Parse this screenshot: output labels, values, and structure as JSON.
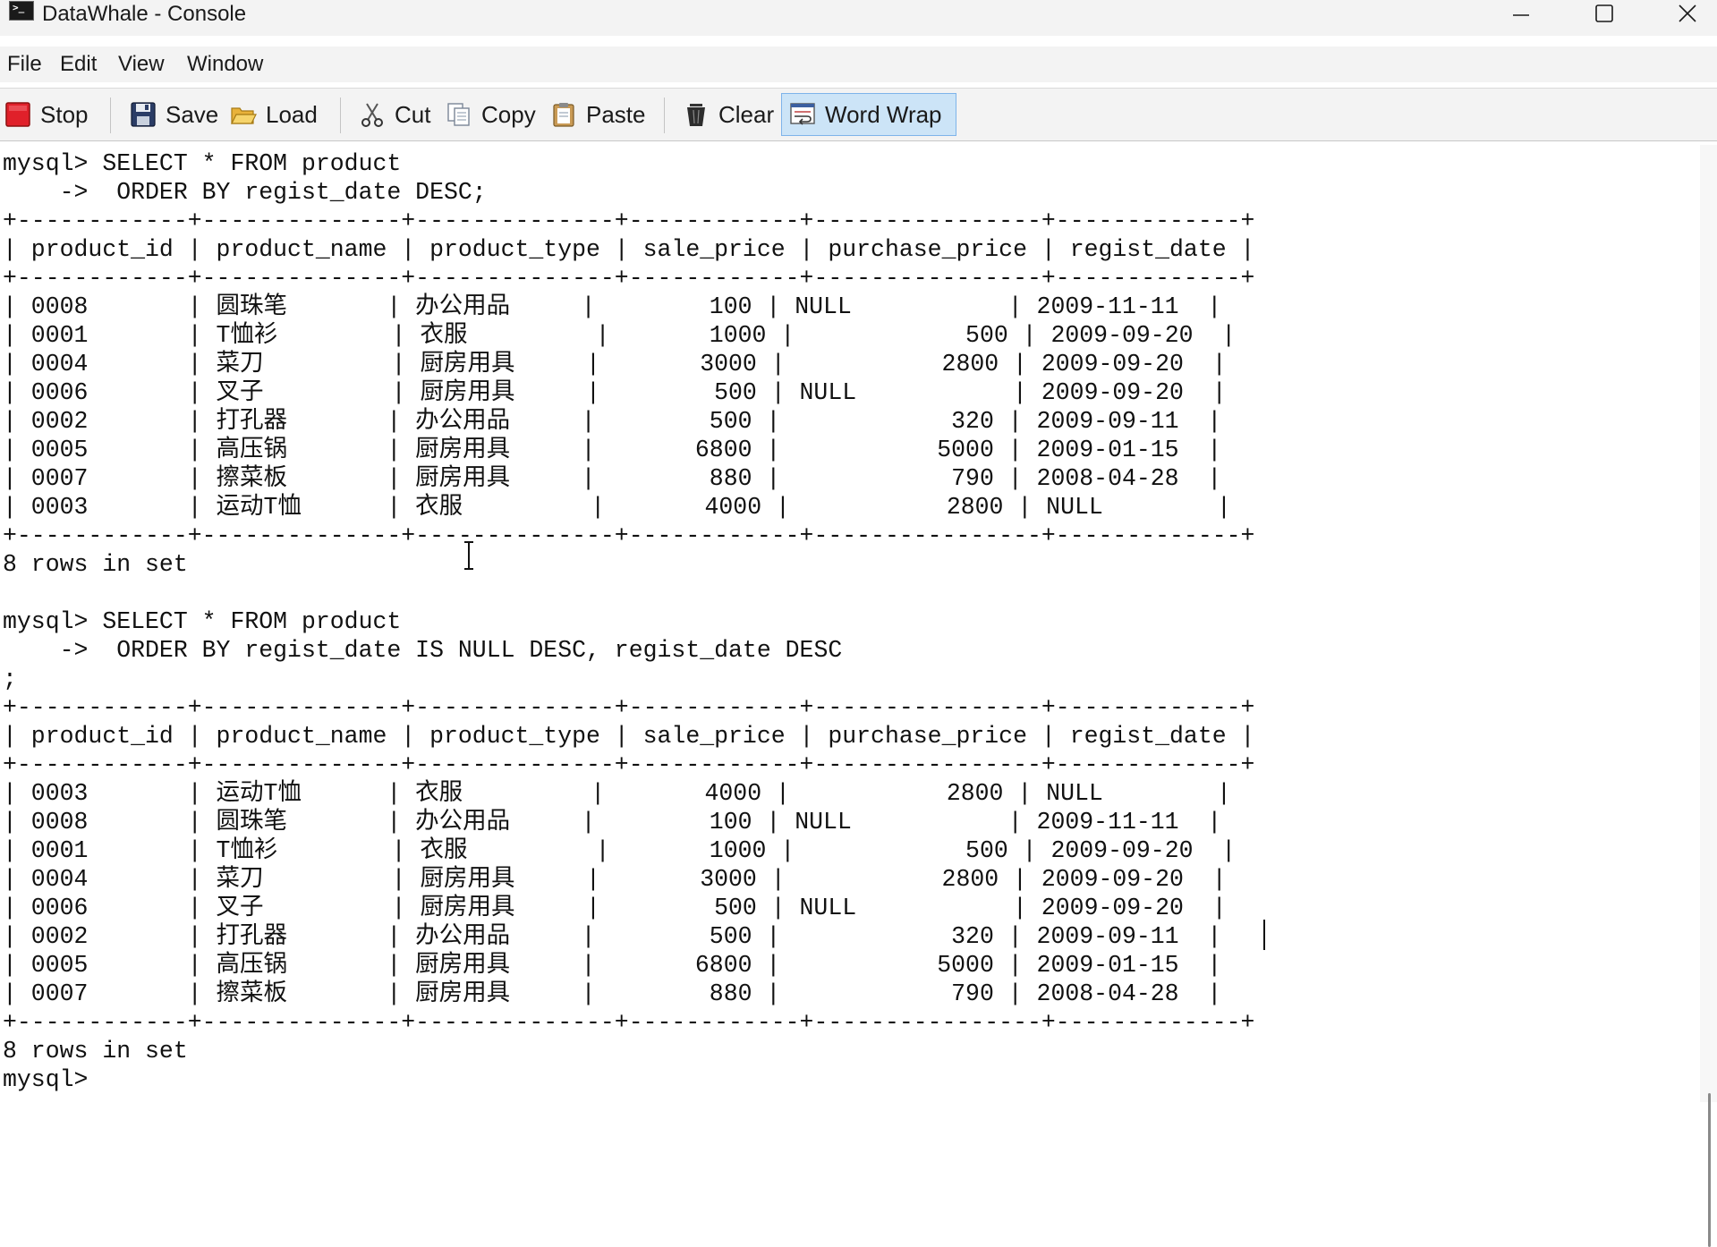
{
  "window": {
    "title": "DataWhale - Console",
    "app_icon_glyph": ">_",
    "controls": [
      "minimize",
      "maximize",
      "close"
    ]
  },
  "menu": {
    "items": [
      "File",
      "Edit",
      "View",
      "Window"
    ]
  },
  "toolbar": {
    "stop_label": "Stop",
    "save_label": "Save",
    "load_label": "Load",
    "cut_label": "Cut",
    "copy_label": "Copy",
    "paste_label": "Paste",
    "clear_label": "Clear",
    "word_wrap_label": "Word Wrap",
    "word_wrap_active": true
  },
  "colors": {
    "toolbar_bg": "#f3f3f3",
    "active_button_bg": "#cce4f7",
    "stop_red": "#e0202a",
    "console_text": "#111111"
  },
  "console": {
    "lines": [
      "mysql> SELECT * FROM product",
      "    ->  ORDER BY regist_date DESC;",
      "+------------+--------------+--------------+------------+----------------+-------------+",
      "| product_id | product_name | product_type | sale_price | purchase_price | regist_date |",
      "+------------+--------------+--------------+------------+----------------+-------------+",
      "| 0008       | 圆珠笔       | 办公用品     |        100 | NULL           | 2009-11-11  |",
      "| 0001       | T恤衫        | 衣服         |       1000 |            500 | 2009-09-20  |",
      "| 0004       | 菜刀         | 厨房用具     |       3000 |           2800 | 2009-09-20  |",
      "| 0006       | 叉子         | 厨房用具     |        500 | NULL           | 2009-09-20  |",
      "| 0002       | 打孔器       | 办公用品     |        500 |            320 | 2009-09-11  |",
      "| 0005       | 高压锅       | 厨房用具     |       6800 |           5000 | 2009-01-15  |",
      "| 0007       | 擦菜板       | 厨房用具     |        880 |            790 | 2008-04-28  |",
      "| 0003       | 运动T恤      | 衣服         |       4000 |           2800 | NULL        |",
      "+------------+--------------+--------------+------------+----------------+-------------+",
      "8 rows in set",
      "",
      "mysql> SELECT * FROM product",
      "    ->  ORDER BY regist_date IS NULL DESC, regist_date DESC",
      ";",
      "+------------+--------------+--------------+------------+----------------+-------------+",
      "| product_id | product_name | product_type | sale_price | purchase_price | regist_date |",
      "+------------+--------------+--------------+------------+----------------+-------------+",
      "| 0003       | 运动T恤      | 衣服         |       4000 |           2800 | NULL        |",
      "| 0008       | 圆珠笔       | 办公用品     |        100 | NULL           | 2009-11-11  |",
      "| 0001       | T恤衫        | 衣服         |       1000 |            500 | 2009-09-20  |",
      "| 0004       | 菜刀         | 厨房用具     |       3000 |           2800 | 2009-09-20  |",
      "| 0006       | 叉子         | 厨房用具     |        500 | NULL           | 2009-09-20  |",
      "| 0002       | 打孔器       | 办公用品     |        500 |            320 | 2009-09-11  |",
      "| 0005       | 高压锅       | 厨房用具     |       6800 |           5000 | 2009-01-15  |",
      "| 0007       | 擦菜板       | 厨房用具     |        880 |            790 | 2008-04-28  |",
      "+------------+--------------+--------------+------------+----------------+-------------+",
      "8 rows in set",
      "mysql>"
    ]
  }
}
